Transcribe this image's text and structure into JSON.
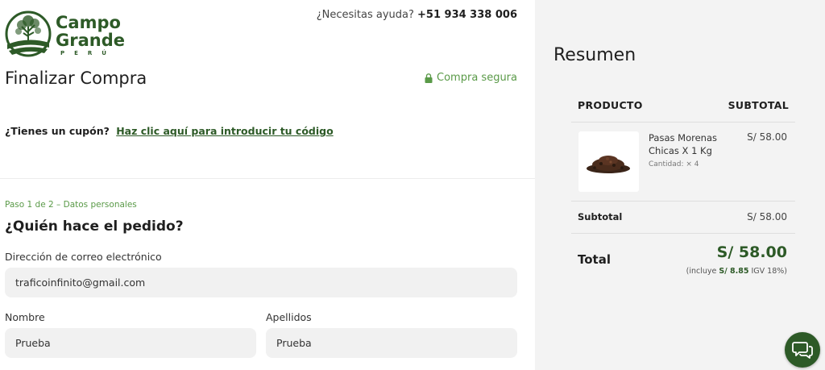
{
  "brand": {
    "name_line1": "Campo",
    "name_line2": "Grande",
    "tagline": "PERÚ",
    "color": "#2d5a27"
  },
  "header": {
    "help_text": "¿Necesitas ayuda?",
    "phone": "+51 934 338 006"
  },
  "checkout": {
    "title": "Finalizar Compra",
    "secure_label": "Compra segura",
    "coupon_prompt": "¿Tienes un cupón?",
    "coupon_link": "Haz clic aquí para introducir tu código",
    "step_label": "Paso 1 de 2 – Datos personales",
    "section_title": "¿Quién hace el pedido?"
  },
  "form": {
    "email_label": "Dirección de correo electrónico",
    "email_value": "traficoinfinito@gmail.com",
    "first_name_label": "Nombre",
    "first_name_value": "Prueba",
    "last_name_label": "Apellidos",
    "last_name_value": "Prueba"
  },
  "summary": {
    "title": "Resumen",
    "col_product": "PRODUCTO",
    "col_subtotal": "SUBTOTAL",
    "items": [
      {
        "name": "Pasas Morenas Chicas X 1 Kg",
        "quantity": "Cantidad: × 4",
        "price": "S/ 58.00"
      }
    ],
    "subtotal_label": "Subtotal",
    "subtotal_value": "S/ 58.00",
    "total_label": "Total",
    "total_value": "S/ 58.00",
    "tax_prefix": "(incluye",
    "tax_amount": "S/ 8.85",
    "tax_suffix": "IGV 18%)"
  },
  "colors": {
    "accent": "#2d5a27",
    "accent_light": "#5a9a48",
    "panel_bg": "#f3f3f3",
    "field_bg": "#f1f1f1"
  },
  "icons": [
    "campo-grande-logo",
    "lock-icon",
    "chat-icon",
    "raisins-product-image"
  ]
}
